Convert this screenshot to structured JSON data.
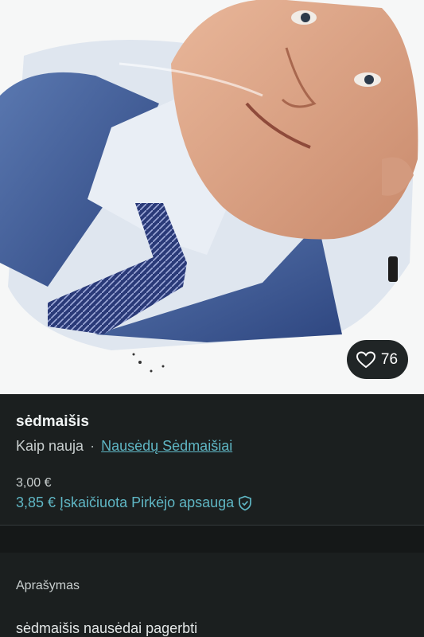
{
  "photo": {
    "favorite_count": "76"
  },
  "listing": {
    "title": "sėdmaišis",
    "condition": "Kaip nauja",
    "separator": "·",
    "brand": "Nausėdų Sėdmaišiai",
    "price": "3,00 €",
    "price_with_protection": "3,85 €",
    "protection_label": "Įskaičiuota Pirkėjo apsauga"
  },
  "description": {
    "label": "Aprašymas",
    "text": "sėdmaišis nausėdai pagerbti"
  },
  "colors": {
    "accent": "#5fb6c4",
    "background": "#1b1f1f"
  }
}
